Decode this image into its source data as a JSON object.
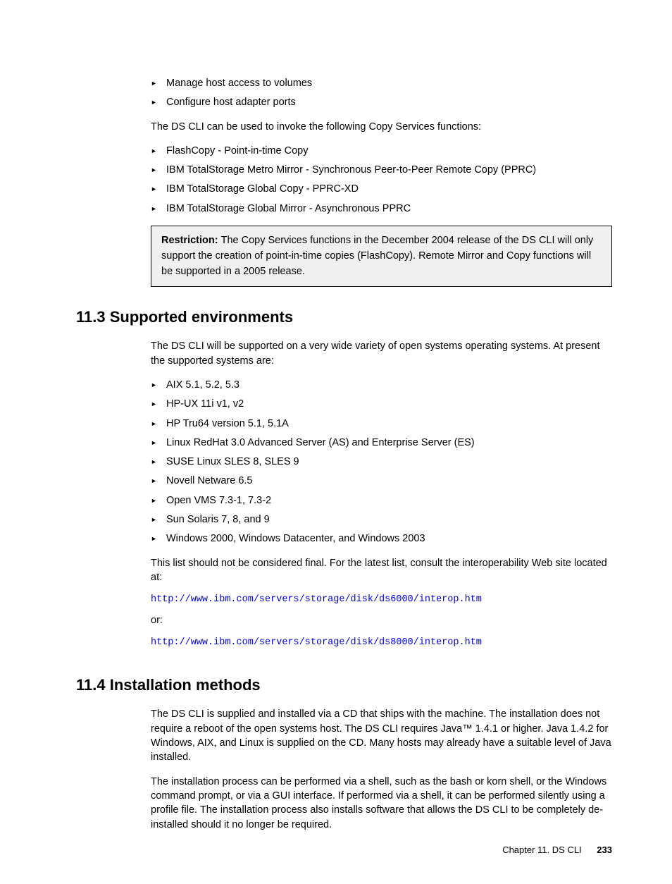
{
  "top_bullets": [
    "Manage host access to volumes",
    "Configure host adapter ports"
  ],
  "intro_para_1": "The DS CLI can be used to invoke the following Copy Services functions:",
  "copy_services_bullets": [
    "FlashCopy - Point-in-time Copy",
    "IBM TotalStorage Metro Mirror - Synchronous Peer-to-Peer Remote Copy (PPRC)",
    "IBM TotalStorage Global Copy - PPRC-XD",
    "IBM TotalStorage Global Mirror - Asynchronous PPRC"
  ],
  "restriction": {
    "label": "Restriction: ",
    "text": "The Copy Services functions in the December 2004 release of the DS CLI will only support the creation of point-in-time copies (FlashCopy). Remote Mirror and Copy functions will be supported in a 2005 release."
  },
  "section_11_3": {
    "heading": "11.3  Supported environments",
    "intro": "The DS CLI will be supported on a very wide variety of open systems operating systems. At present the supported systems are:",
    "env_bullets": [
      "AIX 5.1, 5.2, 5.3",
      "HP-UX 11i v1, v2",
      "HP Tru64 version 5.1, 5.1A",
      "Linux RedHat 3.0 Advanced Server (AS) and Enterprise Server (ES)",
      "SUSE Linux SLES 8, SLES 9",
      "Novell Netware 6.5",
      "Open VMS 7.3-1, 7.3-2",
      "Sun Solaris 7, 8, and 9",
      "Windows 2000, Windows Datacenter, and Windows 2003"
    ],
    "note": "This list should not be considered final. For the latest list, consult the interoperability Web site located at:",
    "link1": "http://www.ibm.com/servers/storage/disk/ds6000/interop.htm",
    "or": "or:",
    "link2": "http://www.ibm.com/servers/storage/disk/ds8000/interop.htm"
  },
  "section_11_4": {
    "heading": "11.4  Installation methods",
    "para1": "The DS CLI is supplied and installed via a CD that ships with the machine. The installation does not require a reboot of the open systems host. The DS CLI requires Java™ 1.4.1 or higher. Java 1.4.2 for Windows, AIX, and Linux is supplied on the CD. Many hosts may already have a suitable level of Java installed.",
    "para2": "The installation process can be performed via a shell, such as the bash or korn shell, or the Windows command prompt, or via a GUI interface. If performed via a shell, it can be performed silently using a profile file. The installation process also installs software that allows the DS CLI to be completely de-installed should it no longer be required."
  },
  "footer": {
    "chapter_label": "Chapter 11. DS CLI",
    "page_number": "233"
  }
}
